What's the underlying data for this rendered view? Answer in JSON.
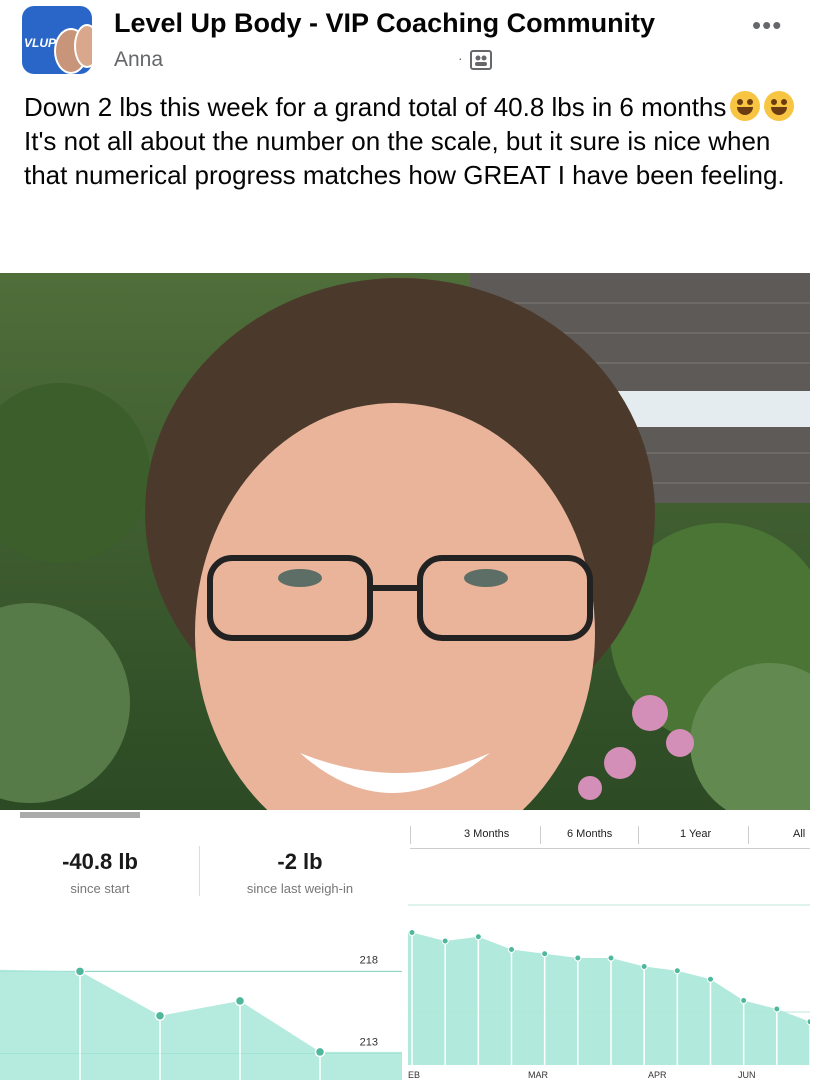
{
  "post": {
    "group_name": "Level Up Body - VIP Coaching Community",
    "author": "Anna",
    "more_label": "•••",
    "avatar_logo": "VLUP",
    "paragraphs": [
      "Down 2 lbs this week for a grand total of 40.8 lbs in 6 months",
      "It's not all about the number on the scale, but it sure is nice when that numerical progress matches how GREAT I have been feeling."
    ]
  },
  "tracker": {
    "total_change": "-40.8 lb",
    "total_caption": "since start",
    "last_change": "-2 lb",
    "last_caption": "since last weigh-in",
    "y_ticks": [
      "218",
      "213"
    ]
  },
  "range_chart": {
    "tabs": [
      "3 Months",
      "6 Months",
      "1 Year",
      "All"
    ],
    "selected_tab": "6 Months",
    "x_labels": [
      "EB",
      "MAR",
      "APR",
      "JUN"
    ]
  },
  "chart_data": [
    {
      "type": "area",
      "title": "",
      "y_ticks": [
        218,
        213
      ],
      "ylim": [
        212,
        221
      ],
      "series": [
        {
          "values": [
            218.1,
            218.0,
            215.3,
            216.2,
            213.1
          ]
        }
      ],
      "color": "#a8e8d8"
    },
    {
      "type": "area",
      "title": "",
      "x_ticks": [
        "EB",
        "MAR",
        "APR",
        "JUN"
      ],
      "series": [
        {
          "values": [
            100,
            98,
            99,
            96,
            95,
            94,
            94,
            92,
            91,
            89,
            84,
            82,
            79
          ]
        }
      ],
      "color": "#a8e8d8"
    }
  ],
  "colors": {
    "accent": "#45c8a8",
    "fill": "#a8e8d8",
    "header_text": "#050505",
    "muted": "#65676b"
  }
}
